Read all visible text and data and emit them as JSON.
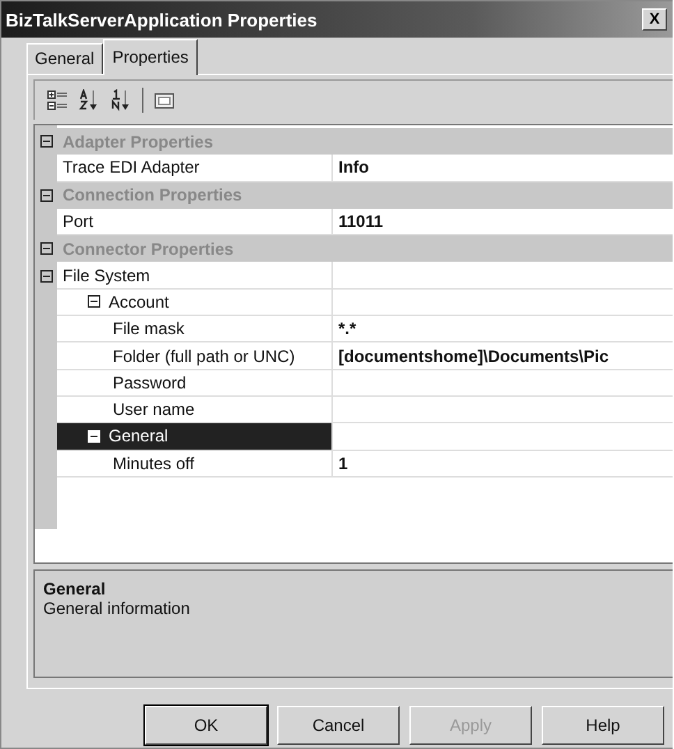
{
  "window": {
    "title": "BizTalkServerApplication Properties",
    "close": "X"
  },
  "tabs": [
    {
      "label": "General",
      "selected": false
    },
    {
      "label": "Properties",
      "selected": true
    }
  ],
  "grid": {
    "rows": [
      {
        "kind": "category",
        "name": "Adapter Properties",
        "expanded": true,
        "children": [
          {
            "kind": "property",
            "name": "Trace EDI Adapter",
            "value": "Info",
            "selected": false
          }
        ]
      },
      {
        "kind": "category",
        "name": "Connection Properties",
        "expanded": true,
        "children": [
          {
            "kind": "property",
            "name": "Port",
            "value": "11011",
            "selected": false
          }
        ]
      },
      {
        "kind": "category",
        "name": "Connector Properties",
        "expanded": true,
        "children": [
          {
            "kind": "property",
            "name": "File System",
            "expanded": true,
            "selected": false,
            "children": [
              {
                "kind": "property",
                "name": "Account",
                "expanded": true,
                "selected": false,
                "children": [
                  {
                    "kind": "property",
                    "name": "File mask",
                    "value": "*.*",
                    "selected": false
                  },
                  {
                    "kind": "property",
                    "name": "Folder (full path or UNC)",
                    "value": "[documentshome]\\Documents\\Pic",
                    "selected": false
                  },
                  {
                    "kind": "property",
                    "name": "Password",
                    "selected": false
                  },
                  {
                    "kind": "property",
                    "name": "User name",
                    "selected": false
                  }
                ]
              },
              {
                "kind": "property",
                "name": "General",
                "expanded": true,
                "selected": true,
                "children": [
                  {
                    "kind": "property",
                    "name": "Minutes off",
                    "value": "1",
                    "selected": false
                  }
                ]
              }
            ]
          }
        ]
      }
    ]
  },
  "description": {
    "title": "General",
    "text": "General information"
  },
  "buttons": [
    {
      "label": "OK",
      "disabled": false
    },
    {
      "label": "Cancel",
      "disabled": false
    },
    {
      "label": "Apply",
      "disabled": true
    },
    {
      "label": "Help",
      "disabled": false
    }
  ]
}
